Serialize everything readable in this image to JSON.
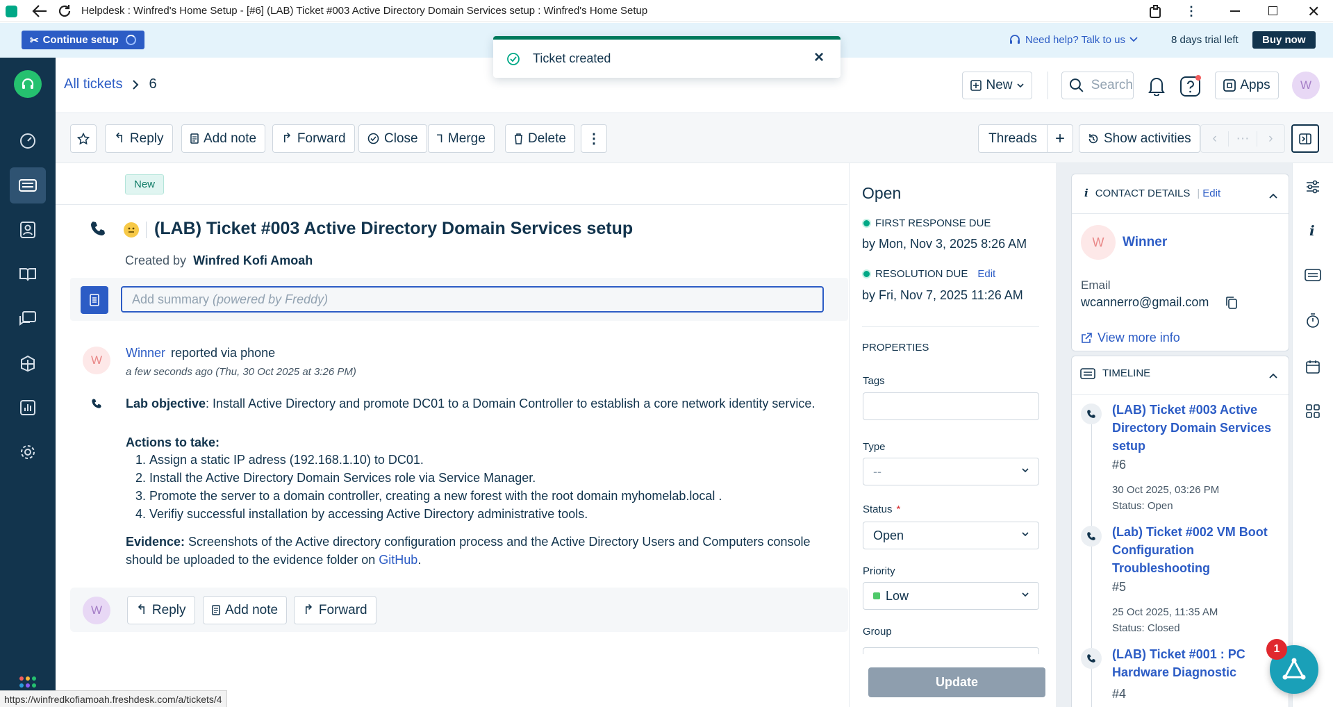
{
  "browser": {
    "window_title": "Helpdesk : Winfred's Home Setup - [#6] (LAB) Ticket #003 Active Directory Domain Services setup : Winfred's Home Setup",
    "status_url": "https://winfredkofiamoah.freshdesk.com/a/tickets/4"
  },
  "setup_bar": {
    "continue_setup": "Continue setup",
    "help_text": "Need help? Talk to us",
    "trial_text": "8 days trial left",
    "buy_now": "Buy now"
  },
  "toast": {
    "message": "Ticket created",
    "close": "×"
  },
  "header": {
    "breadcrumb_link": "All tickets",
    "breadcrumb_current": "6",
    "new_button": "New",
    "search_placeholder": "Search",
    "apps_button": "Apps",
    "avatar_initial": "W"
  },
  "toolbar": {
    "reply": "Reply",
    "add_note": "Add note",
    "forward": "Forward",
    "close": "Close",
    "merge": "Merge",
    "delete": "Delete",
    "threads": "Threads",
    "show_activities": "Show activities",
    "pager_dots": "···"
  },
  "ticket": {
    "status_badge": "New",
    "title": "(LAB) Ticket #003 Active Directory Domain Services setup",
    "created_by_label": "Created by",
    "created_by_name": "Winfred Kofi Amoah",
    "summary_placeholder": "Add summary",
    "summary_hint": "(powered by Freddy)"
  },
  "message": {
    "avatar_initial": "W",
    "author": "Winner",
    "via": "reported via phone",
    "time": "a few seconds ago (Thu, 30 Oct 2025 at 3:26 PM)",
    "objective_label": "Lab objective",
    "objective_text": ": Install Active Directory and promote DC01 to a Domain Controller to establish a core network identity service.",
    "actions_label": "Actions to take:",
    "actions": [
      "Assign a static IP adress (192.168.1.10) to DC01.",
      "Install the Active Directory Domain Services role via Service Manager.",
      "Promote the server to a domain controller, creating a new forest with the root domain myhomelab.local .",
      "Verifiy successful installation by accessing Active Directory administrative tools."
    ],
    "evidence_label": "Evidence:",
    "evidence_text": " Screenshots of the Active directory configuration process and the Active Directory Users and Computers console should be uploaded to the evidence folder on ",
    "evidence_link": "GitHub",
    "evidence_end": "."
  },
  "reply_bar": {
    "avatar_initial": "W",
    "reply": "Reply",
    "add_note": "Add note",
    "forward": "Forward"
  },
  "properties": {
    "status_heading": "Open",
    "first_response_label": "FIRST RESPONSE DUE",
    "first_response_value": "by Mon, Nov 3, 2025 8:26 AM",
    "resolution_label": "RESOLUTION DUE",
    "resolution_edit": "Edit",
    "resolution_value": "by Fri, Nov 7, 2025 11:26 AM",
    "section_title": "PROPERTIES",
    "tags_label": "Tags",
    "type_label": "Type",
    "type_value": "--",
    "status_label": "Status",
    "required_mark": "*",
    "status_value": "Open",
    "priority_label": "Priority",
    "priority_value": "Low",
    "group_label": "Group",
    "update_button": "Update"
  },
  "contact": {
    "heading": "CONTACT DETAILS",
    "edit": "Edit",
    "avatar_initial": "W",
    "name": "Winner",
    "email_label": "Email",
    "email_value": "wcannerro@gmail.com",
    "view_more": "View more info"
  },
  "timeline": {
    "heading": "TIMELINE",
    "items": [
      {
        "title": "(LAB) Ticket #003 Active Directory Domain Services setup",
        "number": "#6",
        "date": "30 Oct 2025, 03:26 PM",
        "status": "Status: Open"
      },
      {
        "title": "(Lab) Ticket #002 VM Boot Configuration Troubleshooting",
        "number": "#5",
        "date": "25 Oct 2025, 11:35 AM",
        "status": "Status: Closed"
      },
      {
        "title": "(LAB) Ticket #001 : PC Hardware Diagnostic",
        "number": "#4",
        "date": "",
        "status": ""
      }
    ]
  },
  "chat_badge": "1",
  "colors": {
    "sidebar": "#12344d",
    "accent": "#2c5cc5",
    "success": "#00a886",
    "priority_low": "#4fc96a"
  }
}
